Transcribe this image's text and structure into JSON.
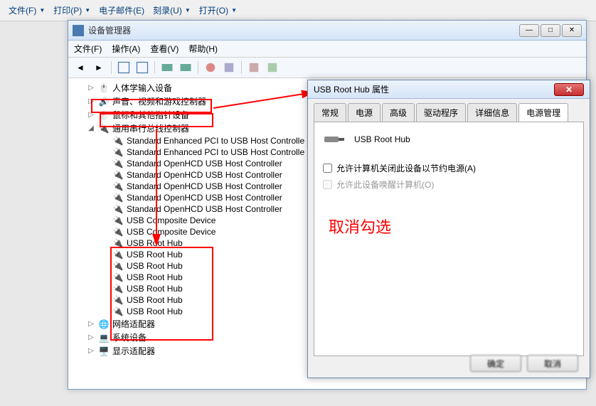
{
  "top_menu": {
    "file": "文件(F)",
    "print": "打印(P)",
    "email": "电子邮件(E)",
    "burn": "刻录(U)",
    "open": "打开(O)"
  },
  "devmgr": {
    "title": "设备管理器",
    "menu": {
      "file": "文件(F)",
      "action": "操作(A)",
      "view": "查看(V)",
      "help": "帮助(H)"
    },
    "tree": {
      "hid": "人体学输入设备",
      "sound": "声音、视频和游戏控制器",
      "mouse": "鼠标和其他指针设备",
      "usb_ctrl": "通用串行总线控制器",
      "items": [
        "Standard Enhanced PCI to USB Host Controlle",
        "Standard Enhanced PCI to USB Host Controlle",
        "Standard OpenHCD USB Host Controller",
        "Standard OpenHCD USB Host Controller",
        "Standard OpenHCD USB Host Controller",
        "Standard OpenHCD USB Host Controller",
        "Standard OpenHCD USB Host Controller",
        "USB Composite Device",
        "USB Composite Device",
        "USB Root Hub",
        "USB Root Hub",
        "USB Root Hub",
        "USB Root Hub",
        "USB Root Hub",
        "USB Root Hub",
        "USB Root Hub"
      ],
      "network": "网络适配器",
      "system": "系统设备",
      "display": "显示适配器"
    }
  },
  "props": {
    "title": "USB Root Hub 属性",
    "tabs": {
      "general": "常规",
      "power": "电源",
      "advanced": "高级",
      "driver": "驱动程序",
      "details": "详细信息",
      "pm": "电源管理"
    },
    "device_name": "USB Root Hub",
    "checkbox1": "允许计算机关闭此设备以节约电源(A)",
    "checkbox2": "允许此设备唤醒计算机(O)",
    "annotation": "取消勾选",
    "ok": "确定",
    "cancel": "取消"
  }
}
